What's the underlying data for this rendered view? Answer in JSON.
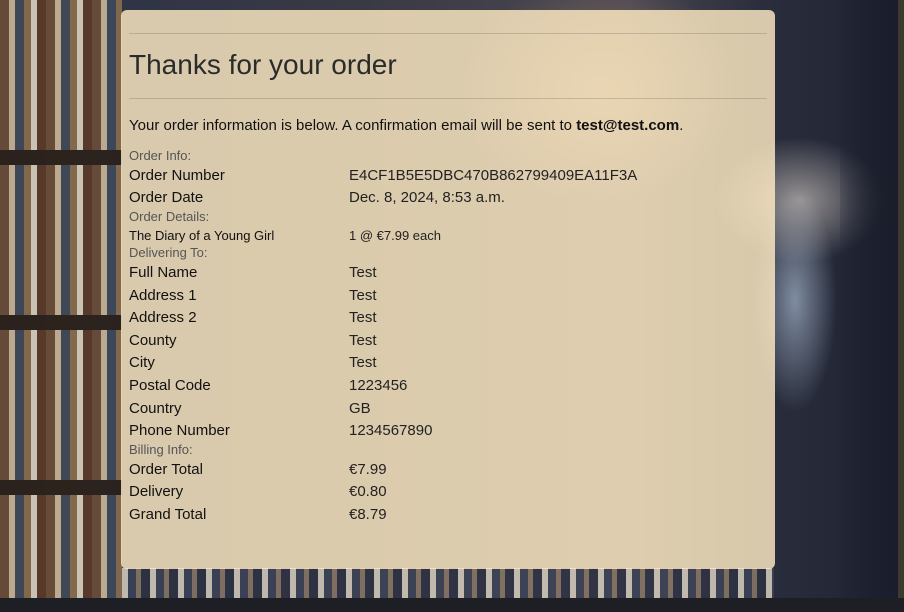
{
  "page": {
    "heading": "Thanks for your order",
    "intro_text": "Your order information is below. A confirmation email will be sent to ",
    "email": "test@test.com",
    "intro_suffix": "."
  },
  "order_info": {
    "label": "Order Info:",
    "rows": [
      {
        "key": "Order Number",
        "value": "E4CF1B5E5DBC470B862799409EA11F3A"
      },
      {
        "key": "Order Date",
        "value": "Dec. 8, 2024, 8:53 a.m."
      }
    ]
  },
  "order_details": {
    "label": "Order Details:",
    "items": [
      {
        "title": "The Diary of a Young Girl",
        "qty_text": "1 @ €7.99 each"
      }
    ]
  },
  "delivering": {
    "label": "Delivering To:",
    "rows": [
      {
        "key": "Full Name",
        "value": "Test"
      },
      {
        "key": "Address 1",
        "value": "Test"
      },
      {
        "key": "Address 2",
        "value": "Test"
      },
      {
        "key": "County",
        "value": "Test"
      },
      {
        "key": "City",
        "value": "Test"
      },
      {
        "key": "Postal Code",
        "value": "1223456"
      },
      {
        "key": "Country",
        "value": "GB"
      },
      {
        "key": "Phone Number",
        "value": "1234567890"
      }
    ]
  },
  "billing": {
    "label": "Billing Info:",
    "rows": [
      {
        "key": "Order Total",
        "value": "€7.99"
      },
      {
        "key": "Delivery",
        "value": "€0.80"
      },
      {
        "key": "Grand Total",
        "value": "€8.79"
      }
    ]
  }
}
